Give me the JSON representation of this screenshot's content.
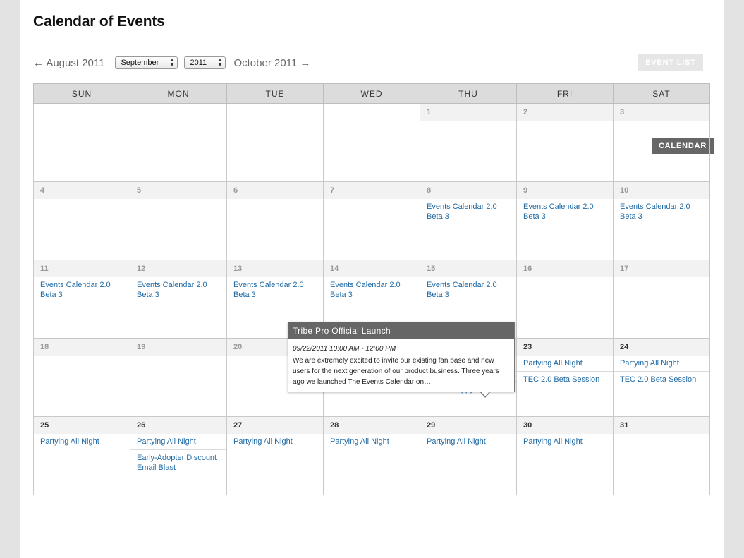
{
  "page_title": "Calendar of Events",
  "nav": {
    "prev_label": "← August 2011",
    "month_value": "September",
    "year_value": "2011",
    "next_label": "October 2011 →"
  },
  "views": {
    "list_label": "EVENT LIST",
    "calendar_label": "CALENDAR"
  },
  "weekdays": [
    "SUN",
    "MON",
    "TUE",
    "WED",
    "THU",
    "FRI",
    "SAT"
  ],
  "weeks": [
    [
      {
        "day": "",
        "events": []
      },
      {
        "day": "",
        "events": []
      },
      {
        "day": "",
        "events": []
      },
      {
        "day": "",
        "events": []
      },
      {
        "day": "1",
        "events": []
      },
      {
        "day": "2",
        "events": []
      },
      {
        "day": "3",
        "events": []
      }
    ],
    [
      {
        "day": "4",
        "events": []
      },
      {
        "day": "5",
        "events": []
      },
      {
        "day": "6",
        "events": []
      },
      {
        "day": "7",
        "events": []
      },
      {
        "day": "8",
        "events": [
          "Events Calendar 2.0 Beta 3"
        ]
      },
      {
        "day": "9",
        "events": [
          "Events Calendar 2.0 Beta 3"
        ]
      },
      {
        "day": "10",
        "events": [
          "Events Calendar 2.0 Beta 3"
        ]
      }
    ],
    [
      {
        "day": "11",
        "events": [
          "Events Calendar 2.0 Beta 3"
        ]
      },
      {
        "day": "12",
        "events": [
          "Events Calendar 2.0 Beta 3"
        ]
      },
      {
        "day": "13",
        "events": [
          "Events Calendar 2.0 Beta 3"
        ]
      },
      {
        "day": "14",
        "events": [
          "Events Calendar 2.0 Beta 3"
        ]
      },
      {
        "day": "15",
        "events": [
          "Events Calendar 2.0 Beta 3"
        ]
      },
      {
        "day": "16",
        "events": []
      },
      {
        "day": "17",
        "events": []
      }
    ],
    [
      {
        "day": "18",
        "events": []
      },
      {
        "day": "19",
        "events": []
      },
      {
        "day": "20",
        "events": []
      },
      {
        "day": "21",
        "events": []
      },
      {
        "day": "22",
        "events": [
          "Tribe Pro Official Launch",
          "Online Happy Hour"
        ]
      },
      {
        "day": "23",
        "events": [
          "Partying All Night",
          "TEC 2.0 Beta Session"
        ]
      },
      {
        "day": "24",
        "events": [
          "Partying All Night",
          "TEC 2.0 Beta Session"
        ]
      }
    ],
    [
      {
        "day": "25",
        "events": [
          "Partying All Night"
        ]
      },
      {
        "day": "26",
        "events": [
          "Partying All Night",
          "Early-Adopter Discount Email Blast"
        ]
      },
      {
        "day": "27",
        "events": [
          "Partying All Night"
        ]
      },
      {
        "day": "28",
        "events": [
          "Partying All Night"
        ]
      },
      {
        "day": "29",
        "events": [
          "Partying All Night"
        ]
      },
      {
        "day": "30",
        "events": [
          "Partying All Night"
        ]
      },
      {
        "day": "31",
        "events": []
      }
    ]
  ],
  "tooltip": {
    "title": "Tribe Pro Official Launch",
    "time": "09/22/2011 10:00 AM - 12:00 PM",
    "body": "We are extremely excited to invite our existing fan base and new users for the next generation of our product business. Three years ago we launched The Events Calendar on…"
  }
}
